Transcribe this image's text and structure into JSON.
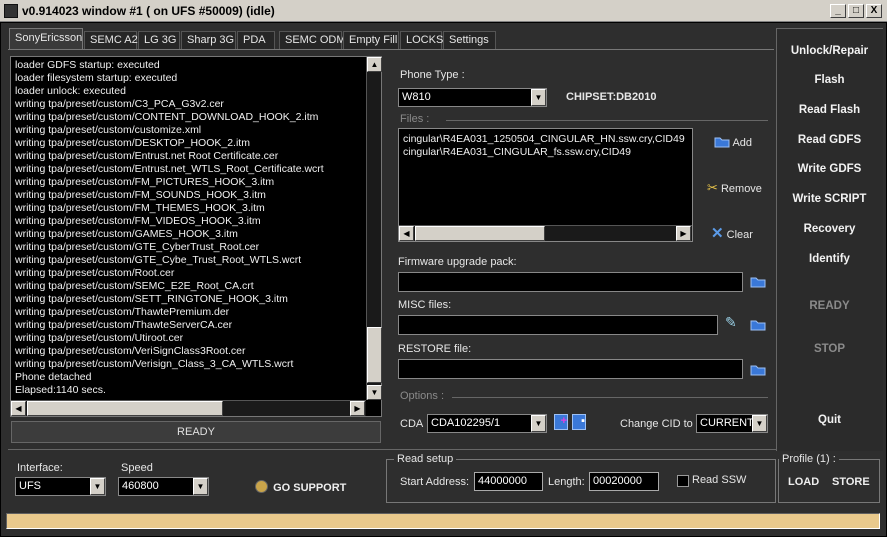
{
  "window": {
    "title": "v0.914023 window #1 ( on UFS #50009) (idle)",
    "min_label": "_",
    "max_label": "□",
    "close_label": "X"
  },
  "tabs": [
    {
      "label": "SonyEricsson",
      "active": true
    },
    {
      "label": "SEMC A2"
    },
    {
      "label": "LG 3G"
    },
    {
      "label": "Sharp 3G"
    },
    {
      "label": "PDA"
    },
    {
      "label": "SEMC ODM"
    },
    {
      "label": "Empty Fill"
    },
    {
      "label": "LOCKS"
    },
    {
      "label": "Settings"
    }
  ],
  "log": {
    "lines": [
      "loader GDFS startup: executed",
      "loader filesystem startup: executed",
      "loader unlock: executed",
      "writing tpa/preset/custom/C3_PCA_G3v2.cer",
      "writing tpa/preset/custom/CONTENT_DOWNLOAD_HOOK_2.itm",
      "writing tpa/preset/custom/customize.xml",
      "writing tpa/preset/custom/DESKTOP_HOOK_2.itm",
      "writing tpa/preset/custom/Entrust.net Root Certificate.cer",
      "writing tpa/preset/custom/Entrust.net_WTLS_Root_Certificate.wcrt",
      "writing tpa/preset/custom/FM_PICTURES_HOOK_3.itm",
      "writing tpa/preset/custom/FM_SOUNDS_HOOK_3.itm",
      "writing tpa/preset/custom/FM_THEMES_HOOK_3.itm",
      "writing tpa/preset/custom/FM_VIDEOS_HOOK_3.itm",
      "writing tpa/preset/custom/GAMES_HOOK_3.itm",
      "writing tpa/preset/custom/GTE_CyberTrust_Root.cer",
      "writing tpa/preset/custom/GTE_Cybe_Trust_Root_WTLS.wcrt",
      "writing tpa/preset/custom/Root.cer",
      "writing tpa/preset/custom/SEMC_E2E_Root_CA.crt",
      "writing tpa/preset/custom/SETT_RINGTONE_HOOK_3.itm",
      "writing tpa/preset/custom/ThawtePremium.der",
      "writing tpa/preset/custom/ThawteServerCA.cer",
      "writing tpa/preset/custom/Utiroot.cer",
      "writing tpa/preset/custom/VeriSignClass3Root.cer",
      "writing tpa/preset/custom/Verisign_Class_3_CA_WTLS.wcrt",
      "Phone detached",
      "Elapsed:1140 secs."
    ],
    "status": "READY"
  },
  "phone": {
    "type_label": "Phone Type :",
    "type_value": "W810",
    "chipset": "CHIPSET:DB2010"
  },
  "files": {
    "label": "Files :",
    "items": [
      "cingular\\R4EA031_1250504_CINGULAR_HN.ssw.cry,CID49",
      "cingular\\R4EA031_CINGULAR_fs.ssw.cry,CID49"
    ],
    "add": "Add",
    "remove": "Remove",
    "clear": "Clear"
  },
  "firmware": {
    "label": "Firmware upgrade pack:",
    "value": ""
  },
  "misc": {
    "label": "MISC files:",
    "value": ""
  },
  "restore": {
    "label": "RESTORE file:",
    "value": ""
  },
  "options": {
    "label": "Options :",
    "cda_label": "CDA",
    "cda_value": "CDA102295/1",
    "change_cid_label": "Change CID to",
    "change_cid_value": "CURRENT"
  },
  "actions": {
    "unlock_repair": "Unlock/Repair",
    "flash": "Flash",
    "read_flash": "Read Flash",
    "read_gdfs": "Read GDFS",
    "write_gdfs": "Write GDFS",
    "write_script": "Write SCRIPT",
    "recovery": "Recovery",
    "identify": "Identify",
    "ready": "READY",
    "stop": "STOP",
    "quit": "Quit"
  },
  "connection": {
    "interface_label": "Interface:",
    "interface_value": "UFS",
    "speed_label": "Speed",
    "speed_value": "460800",
    "go_support": "GO SUPPORT"
  },
  "read_setup": {
    "title": "Read setup",
    "start_label": "Start Address:",
    "start_value": "44000000",
    "length_label": "Length:",
    "length_value": "00020000",
    "read_ssw_label": "Read SSW",
    "read_ssw_checked": false
  },
  "profile": {
    "title": "Profile (1) :",
    "load": "LOAD",
    "store": "STORE"
  },
  "progress": {
    "fraction": 1.0
  },
  "colors": {
    "progress": "#e9c98c",
    "frame": "#2e2e2e",
    "icon_blue": "#3a78d8"
  }
}
